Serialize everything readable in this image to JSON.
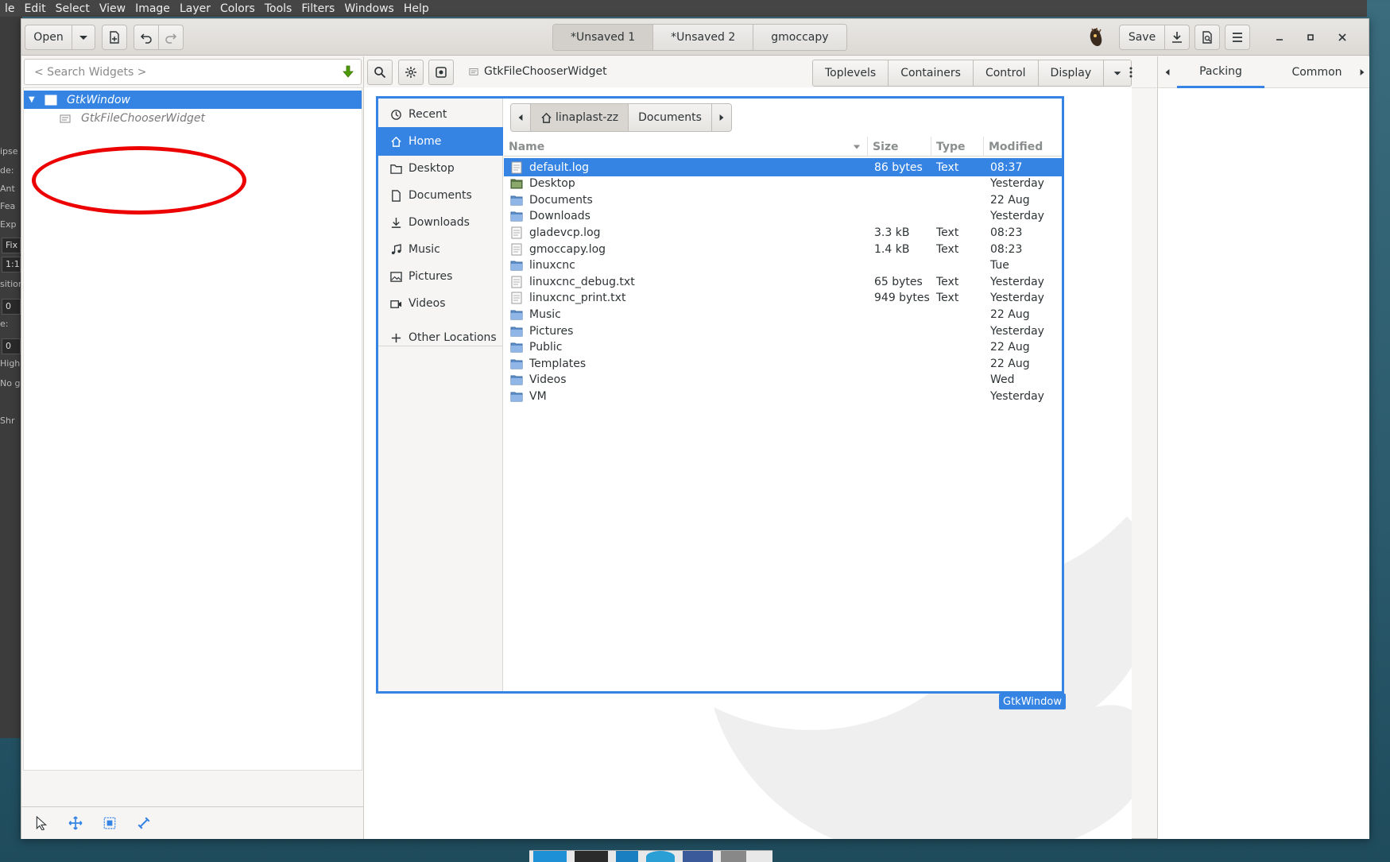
{
  "gimp_menu": [
    "le",
    "Edit",
    "Select",
    "View",
    "Image",
    "Layer",
    "Colors",
    "Tools",
    "Filters",
    "Windows",
    "Help"
  ],
  "gimp_side": [
    "ipse",
    "de:",
    "Ant",
    "Fea",
    "Exp",
    "Fix",
    "1:1",
    "sition",
    "0",
    "e:",
    "0",
    "High",
    "No gu",
    "Shr"
  ],
  "header": {
    "open_label": "Open",
    "tabs": [
      "*Unsaved 1",
      "*Unsaved 2",
      "gmoccapy"
    ],
    "save_label": "Save"
  },
  "inspector": {
    "search_placeholder": "< Search Widgets >",
    "tree": [
      {
        "label": "GtkWindow",
        "selected": true
      },
      {
        "label": "GtkFileChooserWidget",
        "selected": false
      }
    ]
  },
  "toolbar": {
    "selected_widget": "GtkFileChooserWidget",
    "palette_tabs": [
      "Toplevels",
      "Containers",
      "Control",
      "Display"
    ]
  },
  "property_panel": {
    "tabs": [
      "Packing",
      "Common"
    ],
    "active_tab": "Packing"
  },
  "filechooser": {
    "places": [
      {
        "label": "Recent",
        "icon": "clock-icon"
      },
      {
        "label": "Home",
        "icon": "home-icon",
        "selected": true
      },
      {
        "label": "Desktop",
        "icon": "folder-icon"
      },
      {
        "label": "Documents",
        "icon": "document-icon"
      },
      {
        "label": "Downloads",
        "icon": "download-icon"
      },
      {
        "label": "Music",
        "icon": "music-icon"
      },
      {
        "label": "Pictures",
        "icon": "picture-icon"
      },
      {
        "label": "Videos",
        "icon": "video-icon"
      },
      {
        "label": "Other Locations",
        "icon": "plus-icon"
      }
    ],
    "path": [
      "linaplast-zz",
      "Documents"
    ],
    "columns": [
      "Name",
      "Size",
      "Type",
      "Modified"
    ],
    "files": [
      {
        "name": "default.log",
        "size": "86 bytes",
        "type": "Text",
        "modified": "08:37",
        "kind": "file",
        "selected": true
      },
      {
        "name": "Desktop",
        "size": "",
        "type": "",
        "modified": "Yesterday",
        "kind": "desktop"
      },
      {
        "name": "Documents",
        "size": "",
        "type": "",
        "modified": "22 Aug",
        "kind": "folder"
      },
      {
        "name": "Downloads",
        "size": "",
        "type": "",
        "modified": "Yesterday",
        "kind": "folder"
      },
      {
        "name": "gladevcp.log",
        "size": "3.3 kB",
        "type": "Text",
        "modified": "08:23",
        "kind": "file"
      },
      {
        "name": "gmoccapy.log",
        "size": "1.4 kB",
        "type": "Text",
        "modified": "08:23",
        "kind": "file"
      },
      {
        "name": "linuxcnc",
        "size": "",
        "type": "",
        "modified": "Tue",
        "kind": "folder"
      },
      {
        "name": "linuxcnc_debug.txt",
        "size": "65 bytes",
        "type": "Text",
        "modified": "Yesterday",
        "kind": "file"
      },
      {
        "name": "linuxcnc_print.txt",
        "size": "949 bytes",
        "type": "Text",
        "modified": "Yesterday",
        "kind": "file"
      },
      {
        "name": "Music",
        "size": "",
        "type": "",
        "modified": "22 Aug",
        "kind": "folder"
      },
      {
        "name": "Pictures",
        "size": "",
        "type": "",
        "modified": "Yesterday",
        "kind": "folder"
      },
      {
        "name": "Public",
        "size": "",
        "type": "",
        "modified": "22 Aug",
        "kind": "folder"
      },
      {
        "name": "Templates",
        "size": "",
        "type": "",
        "modified": "22 Aug",
        "kind": "folder"
      },
      {
        "name": "Videos",
        "size": "",
        "type": "",
        "modified": "Wed",
        "kind": "folder"
      },
      {
        "name": "VM",
        "size": "",
        "type": "",
        "modified": "Yesterday",
        "kind": "folder"
      }
    ],
    "window_label": "GtkWindow"
  },
  "colors": {
    "accent": "#3584e4",
    "annotation": "#ec0000"
  }
}
